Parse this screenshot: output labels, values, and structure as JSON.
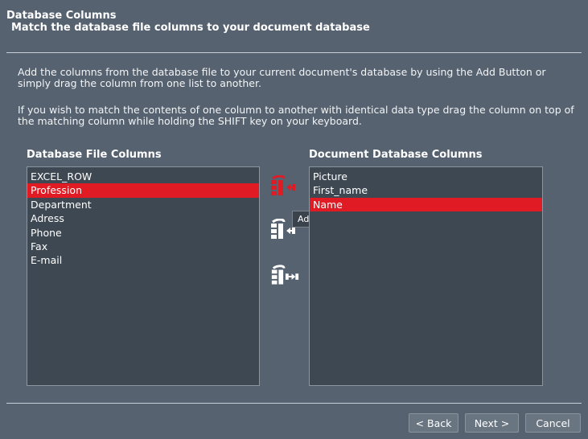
{
  "header": {
    "title": "Database Columns",
    "subtitle": "Match the database file columns to your document database"
  },
  "instructions": {
    "p1": "Add the columns from the database file to your current document's database by using the Add Button or simply drag the column from one list to another.",
    "p2": "If you wish to match the contents of one column to another with identical data type drag the column on top of the matching column while holding the SHIFT key on your keyboard."
  },
  "left_list": {
    "title": "Database File Columns",
    "items": [
      "EXCEL_ROW",
      "Profession",
      "Department",
      "Adress",
      "Phone",
      "Fax",
      "E-mail"
    ],
    "selected": "Profession"
  },
  "right_list": {
    "title": "Document Database Columns",
    "items": [
      "Picture",
      "First_name",
      "Name"
    ],
    "selected": "Name"
  },
  "action_icons": {
    "add_column_icon": "add-table-column-icon",
    "add_all_icon": "insert-column-icon",
    "match_column_icon": "match-column-icon",
    "active_color": "#e01b24"
  },
  "tooltip": "Add table column",
  "buttons": {
    "back": "< Back",
    "next": "Next >",
    "cancel": "Cancel"
  },
  "colors": {
    "background": "#566270",
    "list_bg": "#3e4852",
    "selection": "#e01b24"
  }
}
